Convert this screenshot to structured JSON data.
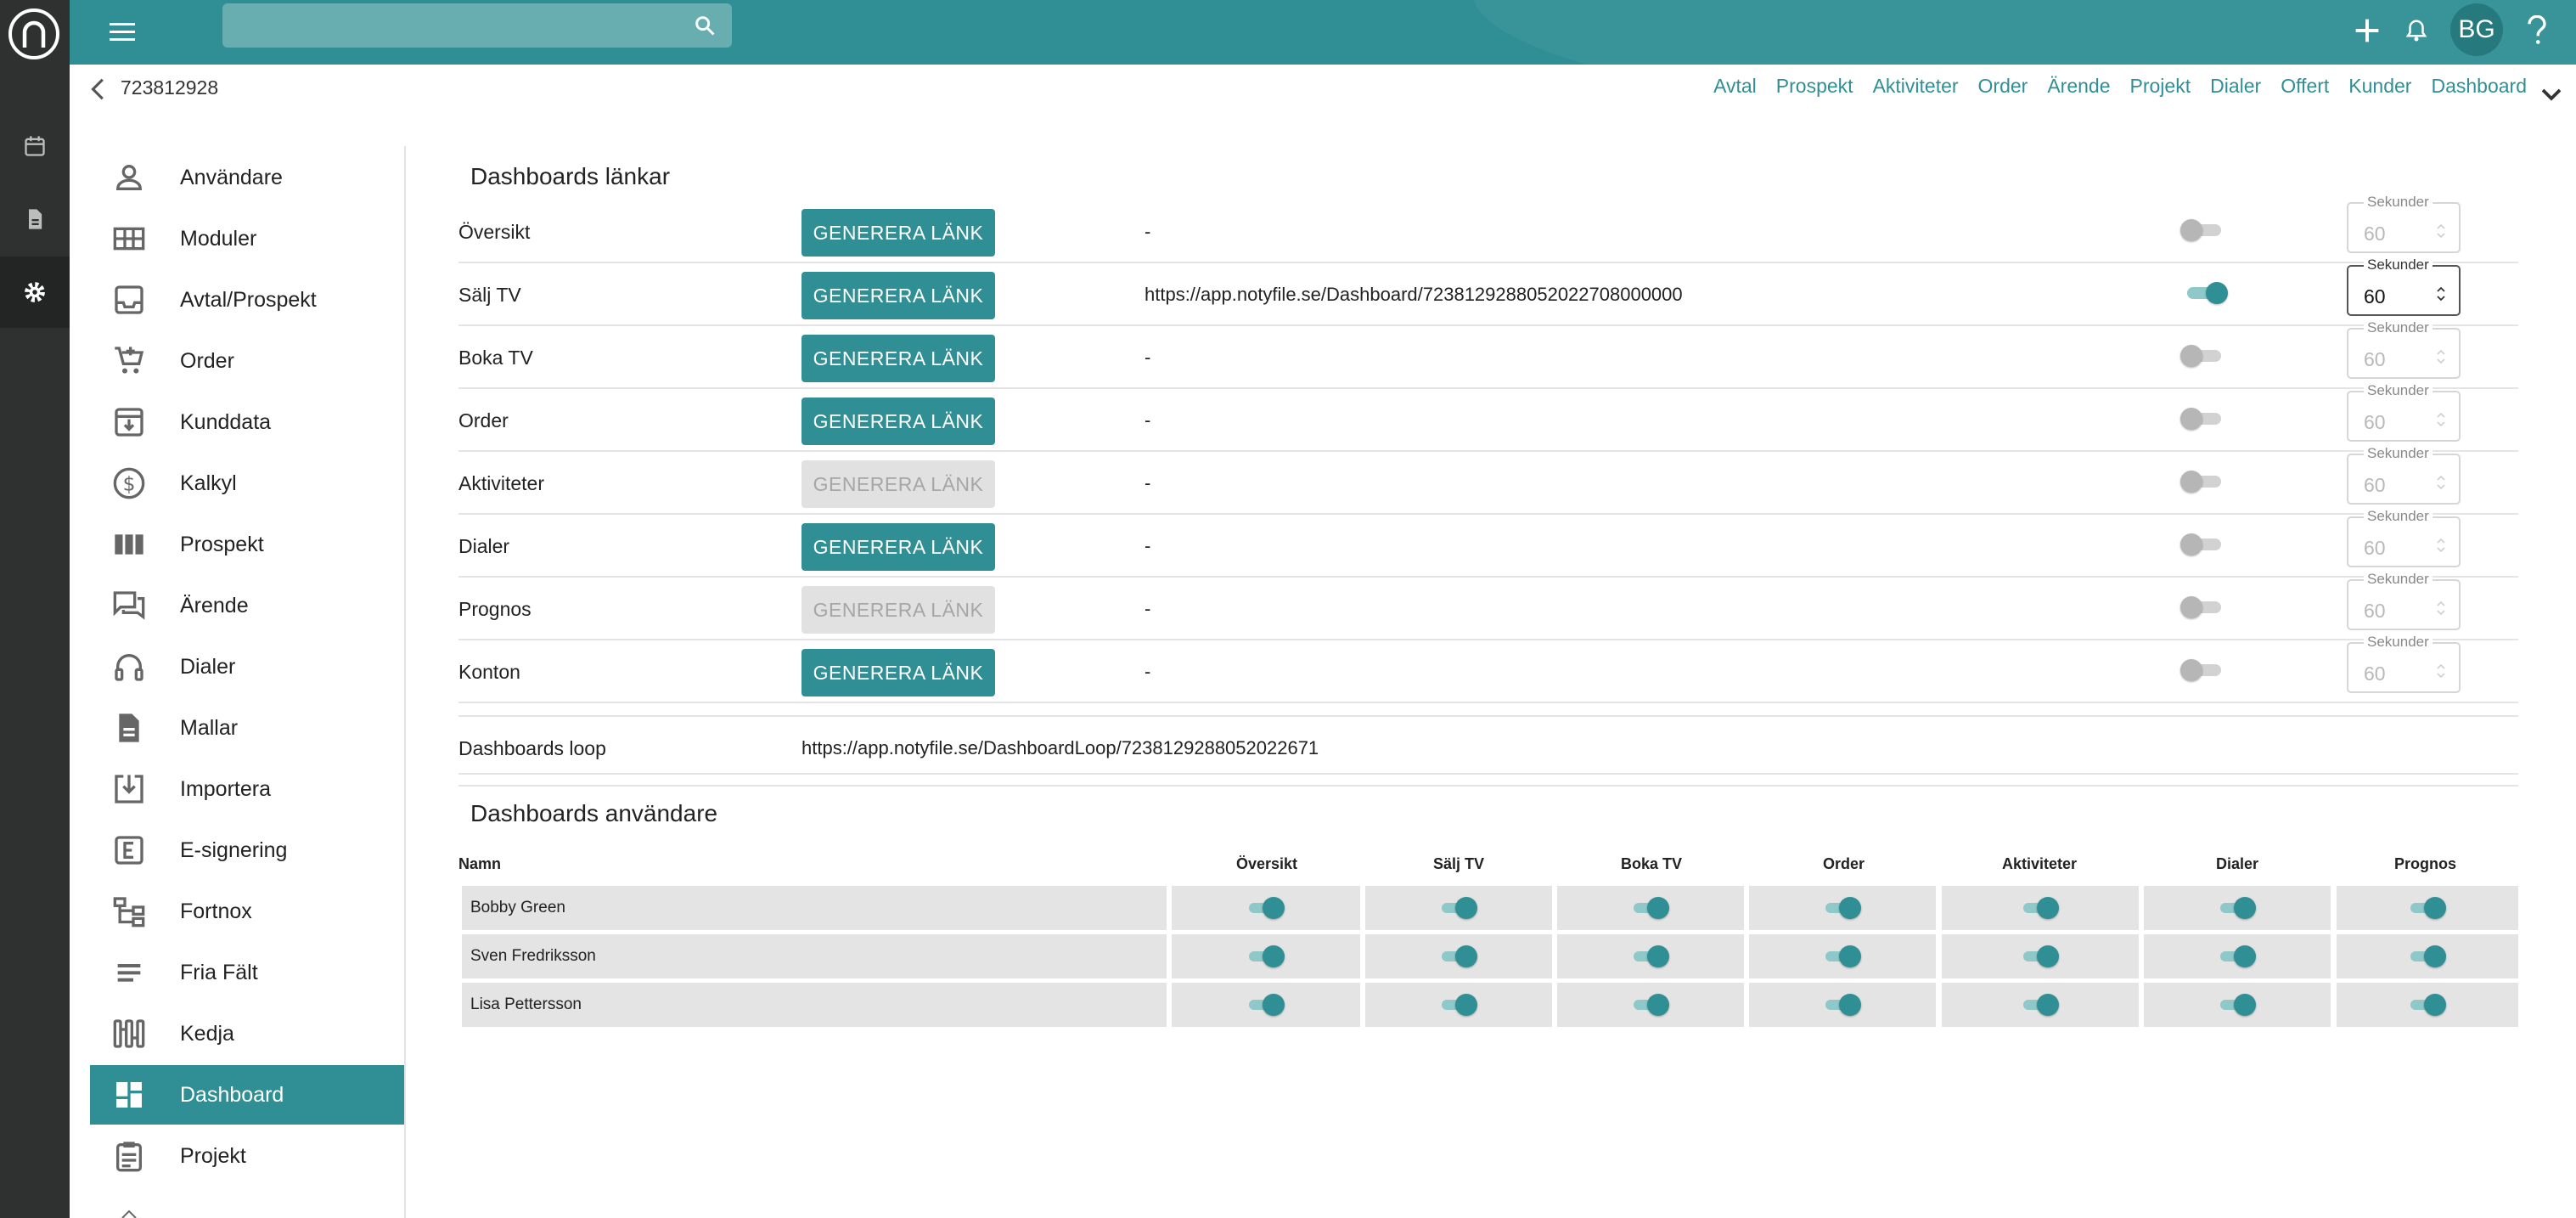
{
  "header": {
    "search_placeholder": "",
    "avatar_initials": "BG"
  },
  "subheader": {
    "record_id": "723812928",
    "quicklinks": [
      "Avtal",
      "Prospekt",
      "Aktiviteter",
      "Order",
      "Ärende",
      "Projekt",
      "Dialer",
      "Offert",
      "Kunder",
      "Dashboard"
    ]
  },
  "sidebar": {
    "active": "Dashboard",
    "items": [
      {
        "label": "Användare",
        "icon": "person-icon"
      },
      {
        "label": "Moduler",
        "icon": "grid-icon"
      },
      {
        "label": "Avtal/Prospekt",
        "icon": "inbox-icon"
      },
      {
        "label": "Order",
        "icon": "cart-icon"
      },
      {
        "label": "Kunddata",
        "icon": "archive-icon"
      },
      {
        "label": "Kalkyl",
        "icon": "dollar-icon"
      },
      {
        "label": "Prospekt",
        "icon": "columns-icon"
      },
      {
        "label": "Ärende",
        "icon": "chat-icon"
      },
      {
        "label": "Dialer",
        "icon": "headset-icon"
      },
      {
        "label": "Mallar",
        "icon": "document-icon"
      },
      {
        "label": "Importera",
        "icon": "import-icon"
      },
      {
        "label": "E-signering",
        "icon": "e-sign-icon"
      },
      {
        "label": "Fortnox",
        "icon": "hierarchy-icon"
      },
      {
        "label": "Fria Fält",
        "icon": "lines-icon"
      },
      {
        "label": "Kedja",
        "icon": "chain-icon"
      },
      {
        "label": "Dashboard",
        "icon": "dashboard-icon"
      },
      {
        "label": "Projekt",
        "icon": "clipboard-icon"
      }
    ]
  },
  "dashboards_links": {
    "title": "Dashboards länkar",
    "button_label": "GENERERA LÄNK",
    "seconds_label": "Sekunder",
    "rows": [
      {
        "name": "Översikt",
        "enabled": true,
        "link": "-",
        "toggle": false,
        "seconds": "60"
      },
      {
        "name": "Sälj TV",
        "enabled": true,
        "link": "https://app.notyfile.se/Dashboard/7238129288052022708000000",
        "toggle": true,
        "seconds": "60"
      },
      {
        "name": "Boka TV",
        "enabled": true,
        "link": "-",
        "toggle": false,
        "seconds": "60"
      },
      {
        "name": "Order",
        "enabled": true,
        "link": "-",
        "toggle": false,
        "seconds": "60"
      },
      {
        "name": "Aktiviteter",
        "enabled": false,
        "link": "-",
        "toggle": false,
        "seconds": "60"
      },
      {
        "name": "Dialer",
        "enabled": true,
        "link": "-",
        "toggle": false,
        "seconds": "60"
      },
      {
        "name": "Prognos",
        "enabled": false,
        "link": "-",
        "toggle": false,
        "seconds": "60"
      },
      {
        "name": "Konton",
        "enabled": true,
        "link": "-",
        "toggle": false,
        "seconds": "60"
      }
    ],
    "loop_label": "Dashboards loop",
    "loop_link": "https://app.notyfile.se/DashboardLoop/7238129288052022671"
  },
  "dashboards_users": {
    "title": "Dashboards användare",
    "columns": [
      "Namn",
      "Översikt",
      "Sälj TV",
      "Boka TV",
      "Order",
      "Aktiviteter",
      "Dialer",
      "Prognos"
    ],
    "rows": [
      {
        "name": "Bobby Green",
        "values": [
          true,
          true,
          true,
          true,
          true,
          true,
          true
        ]
      },
      {
        "name": "Sven Fredriksson",
        "values": [
          true,
          true,
          true,
          true,
          true,
          true,
          true
        ]
      },
      {
        "name": "Lisa Pettersson",
        "values": [
          true,
          true,
          true,
          true,
          true,
          true,
          true
        ]
      }
    ]
  },
  "colors": {
    "accent": "#2f8f94",
    "rail": "#2f3131",
    "disabled_button": "#e1e1e1"
  }
}
